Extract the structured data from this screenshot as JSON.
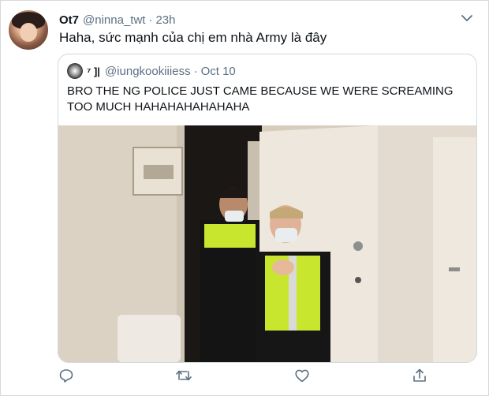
{
  "tweet": {
    "author_name": "Ot7",
    "author_handle": "@ninna_twt",
    "separator": "·",
    "time": "23h",
    "text": "Haha, sức mạnh của chị em nhà Army là đây"
  },
  "quoted_tweet": {
    "author_name": "⁷ ]|",
    "author_handle": "@iungkookiiiess",
    "separator": "·",
    "date": "Oct 10",
    "text": "BRO THE        NG POLICE JUST CAME BECAUSE WE WERE SCREAMING TOO MUCH HAHAHAHAHAHAHA",
    "media_alt": "Photo of two police officers wearing face masks and high-visibility vests standing in a doorway"
  },
  "actions": [
    "reply-icon",
    "retweet-icon",
    "like-icon",
    "share-icon"
  ],
  "colors": {
    "text_primary": "#0f1419",
    "text_secondary": "#5b7083",
    "border": "#cfd9de",
    "police_vest": "#c8e62e"
  }
}
